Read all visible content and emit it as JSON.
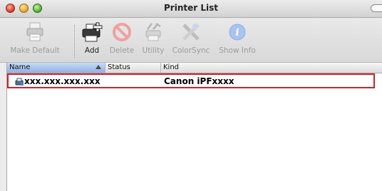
{
  "window": {
    "title": "Printer List"
  },
  "toolbar": {
    "items": [
      {
        "label": "Make Default",
        "icon": "printer-default-icon",
        "enabled": false
      },
      {
        "label": "Add",
        "icon": "add-printer-icon",
        "enabled": true
      },
      {
        "label": "Delete",
        "icon": "delete-icon",
        "enabled": false
      },
      {
        "label": "Utility",
        "icon": "utility-icon",
        "enabled": false
      },
      {
        "label": "ColorSync",
        "icon": "colorsync-icon",
        "enabled": false
      },
      {
        "label": "Show Info",
        "icon": "info-icon",
        "enabled": false
      }
    ]
  },
  "list": {
    "columns": [
      "Name",
      "Status",
      "Kind"
    ],
    "sorted_column": "Name",
    "rows": [
      {
        "name": "xxx.xxx.xxx.xxx",
        "status": "",
        "kind": "Canon iPFxxxx",
        "highlighted": true
      }
    ]
  },
  "colors": {
    "highlight_border": "#d21f2a",
    "header_sorted": "#9bb9ea"
  }
}
